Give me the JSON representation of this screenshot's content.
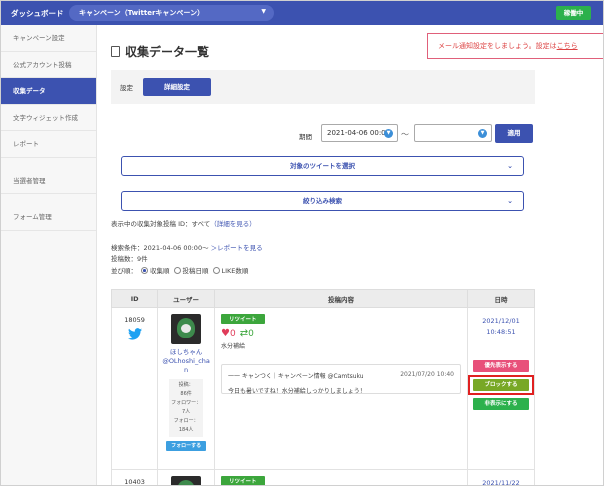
{
  "topbar": {
    "title": "ダッシュボード",
    "campaign_select": "キャンペーン（Twitterキャンペーン）",
    "status": "稼働中"
  },
  "sidebar": {
    "items": [
      {
        "label": "キャンペーン設定"
      },
      {
        "label": "公式アカウント投稿"
      },
      {
        "label": "収集データ"
      },
      {
        "label": "文字ウィジェット作成"
      },
      {
        "label": "レポート"
      },
      {
        "label": "当選者管理"
      },
      {
        "label": "フォーム管理"
      }
    ]
  },
  "page": {
    "title": "収集データ一覧",
    "notice_text": "メール通知設定をしましょう。設定は",
    "notice_link": "こちら"
  },
  "settings": {
    "label": "設定",
    "detail_button": "詳細設定"
  },
  "period": {
    "label": "期間",
    "start_value": "2021-04-06 00:00",
    "end_value": "",
    "separator": "〜",
    "apply_button": "適用"
  },
  "accordions": {
    "target_tweet": "対象のツイートを選択",
    "filter_search": "絞り込み検索"
  },
  "info": {
    "target_prefix": "表示中の収集対象投稿 ID：すべて",
    "target_link": "（詳細を見る）",
    "search_condition": "検索条件：2021-04-06 00:00〜",
    "report_link": "＞レポートを見る",
    "post_count": "投稿数：9件",
    "sort_label": "並び順：",
    "sort_options": [
      "収集順",
      "投稿日順",
      "LIKE数順"
    ]
  },
  "table": {
    "headers": [
      "ID",
      "ユーザー",
      "投稿内容",
      "日時"
    ],
    "rows": [
      {
        "id": "18059",
        "user_name": "ほしちゃん",
        "user_handle_1": "@OLhoshi_cha",
        "user_handle_2": "n",
        "stat_posts_label": "投稿：",
        "stat_posts_value": "86件",
        "stat_followers_label": "フォロワー：",
        "stat_followers_value": "7人",
        "stat_follow_label": "フォロー：",
        "stat_follow_value": "184人",
        "follow_button": "フォローする",
        "post_type": "リツイート",
        "likes": "0",
        "retweets": "0",
        "post_text": "水分補給",
        "quote_header": "一一 キャンつく｜キャンペーン情報 @Camtsuku",
        "quote_date": "2021/07/20 10:40",
        "quote_text": "今日も暑いですね！水分補給しっかりしましょう！",
        "date": "2021/12/01",
        "time": "10:48:51",
        "btn_priority": "優先表示する",
        "btn_block": "ブロックする",
        "btn_hide": "非表示にする"
      },
      {
        "id": "10403",
        "post_type": "リツイート",
        "date": "2021/11/22"
      }
    ]
  },
  "colors": {
    "brand": "#3c52b0",
    "status": "#2cb14c",
    "retweet": "#3ca63c",
    "like": "#e03c5a",
    "highlight": "#e02020"
  }
}
